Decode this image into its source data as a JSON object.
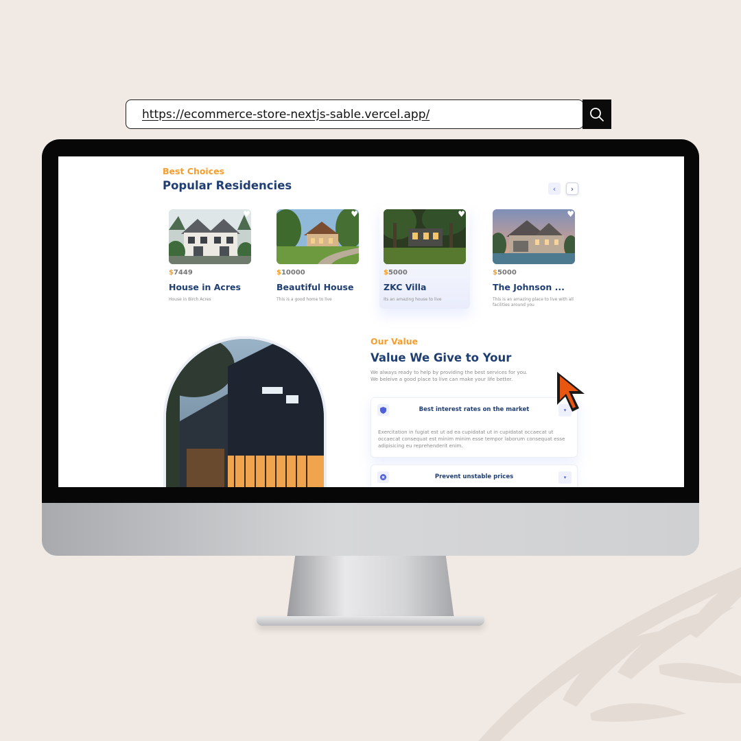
{
  "url_bar": {
    "url": "https://ecommerce-store-nextjs-sable.vercel.app/",
    "search_icon": "search-icon"
  },
  "residencies": {
    "eyebrow": "Best Choices",
    "heading": "Popular Residencies",
    "prev_icon": "chevron-left-icon",
    "next_icon": "chevron-right-icon",
    "prev_label": "‹",
    "next_label": "›",
    "cards": [
      {
        "currency": "$",
        "price": "7449",
        "title": "House in Acres",
        "desc": "House in Birch Acres"
      },
      {
        "currency": "$",
        "price": "10000",
        "title": "Beautiful House",
        "desc": "This is a good home to live"
      },
      {
        "currency": "$",
        "price": "5000",
        "title": "ZKC Villa",
        "desc": "Its an amazing house to live"
      },
      {
        "currency": "$",
        "price": "5000",
        "title": "The Johnson ...",
        "desc": "This is an amazing place to live with all facilities around you"
      }
    ]
  },
  "value": {
    "eyebrow": "Our Value",
    "heading": "Value We Give to Your",
    "line1": "We always ready to help by providing the best services for you.",
    "line2": "We beleive a good place to live can make your life better.",
    "accordion": [
      {
        "title": "Best interest rates on the market",
        "body": "Exercitation in fugiat est ut ad ea cupidatat ut in cupidatat occaecat ut occaecat consequat est minim minim esse tempor laborum consequat esse adipisicing eu reprehenderit enim.",
        "icon": "shield-icon",
        "expanded": true
      },
      {
        "title": "Prevent unstable prices",
        "icon": "cancel-icon",
        "expanded": false
      }
    ]
  },
  "colors": {
    "accent_orange": "#f59e2e",
    "heading_navy": "#1f3e72",
    "cursor_orange": "#e8560f"
  }
}
